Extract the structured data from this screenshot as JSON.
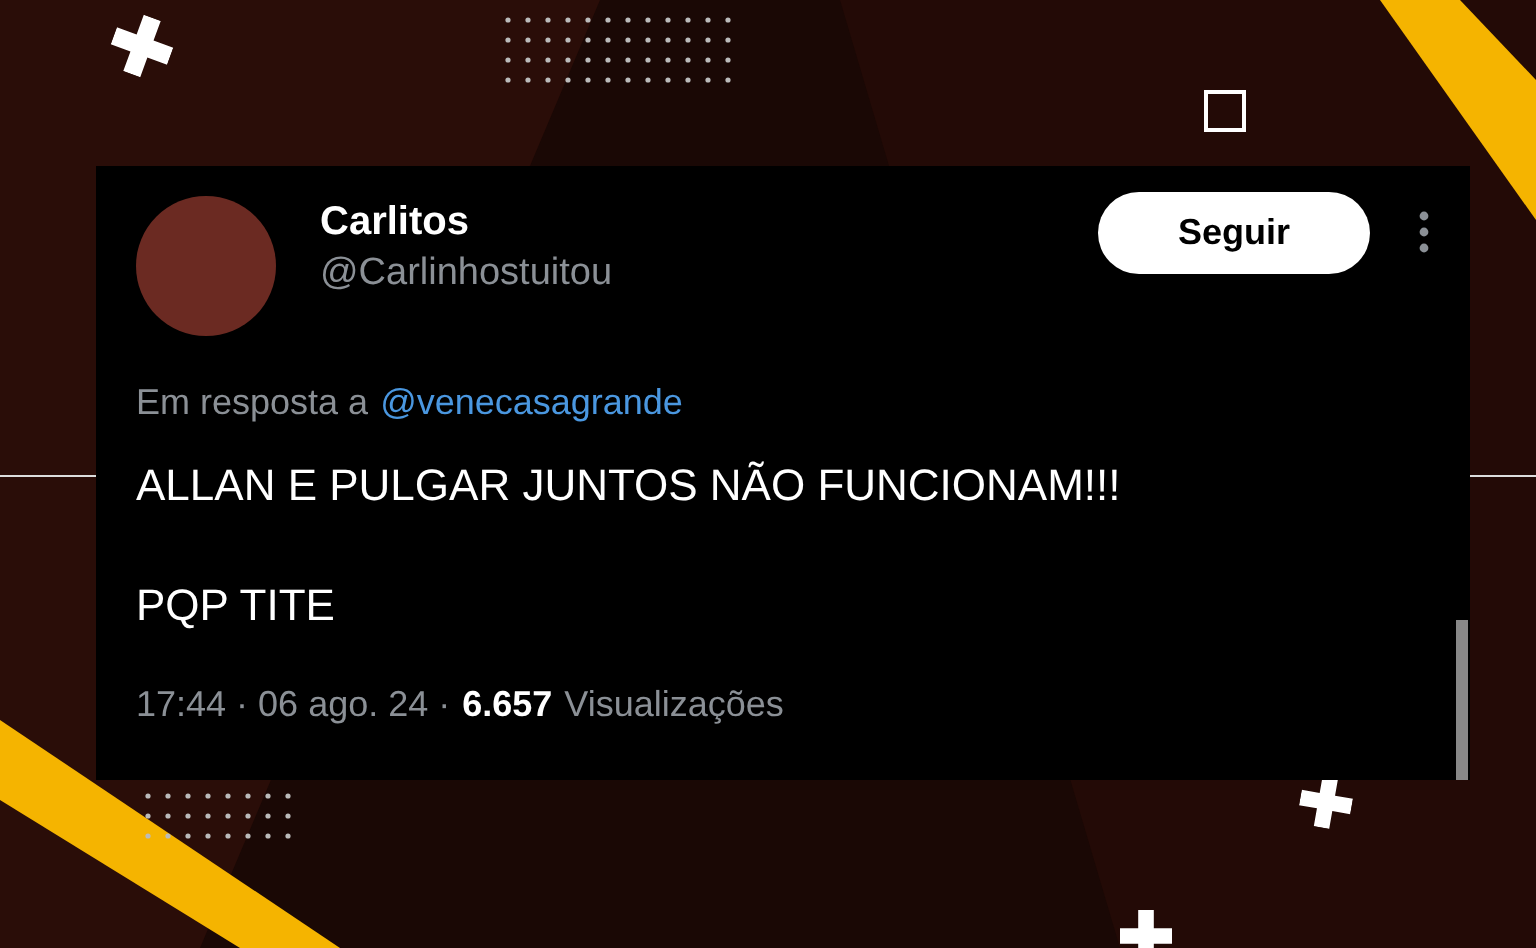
{
  "author": {
    "name": "Carlitos",
    "handle": "@Carlinhostuitou"
  },
  "follow_button": "Seguir",
  "reply": {
    "prefix": "Em resposta a",
    "mention": "@venecasagrande"
  },
  "body": [
    "ALLAN E PULGAR JUNTOS NÃO FUNCIONAM!!!",
    "PQP TITE"
  ],
  "meta": {
    "date": "17:44 · 06 ago. 24 ·",
    "views_count": "6.657",
    "views_label": "Visualizações"
  }
}
